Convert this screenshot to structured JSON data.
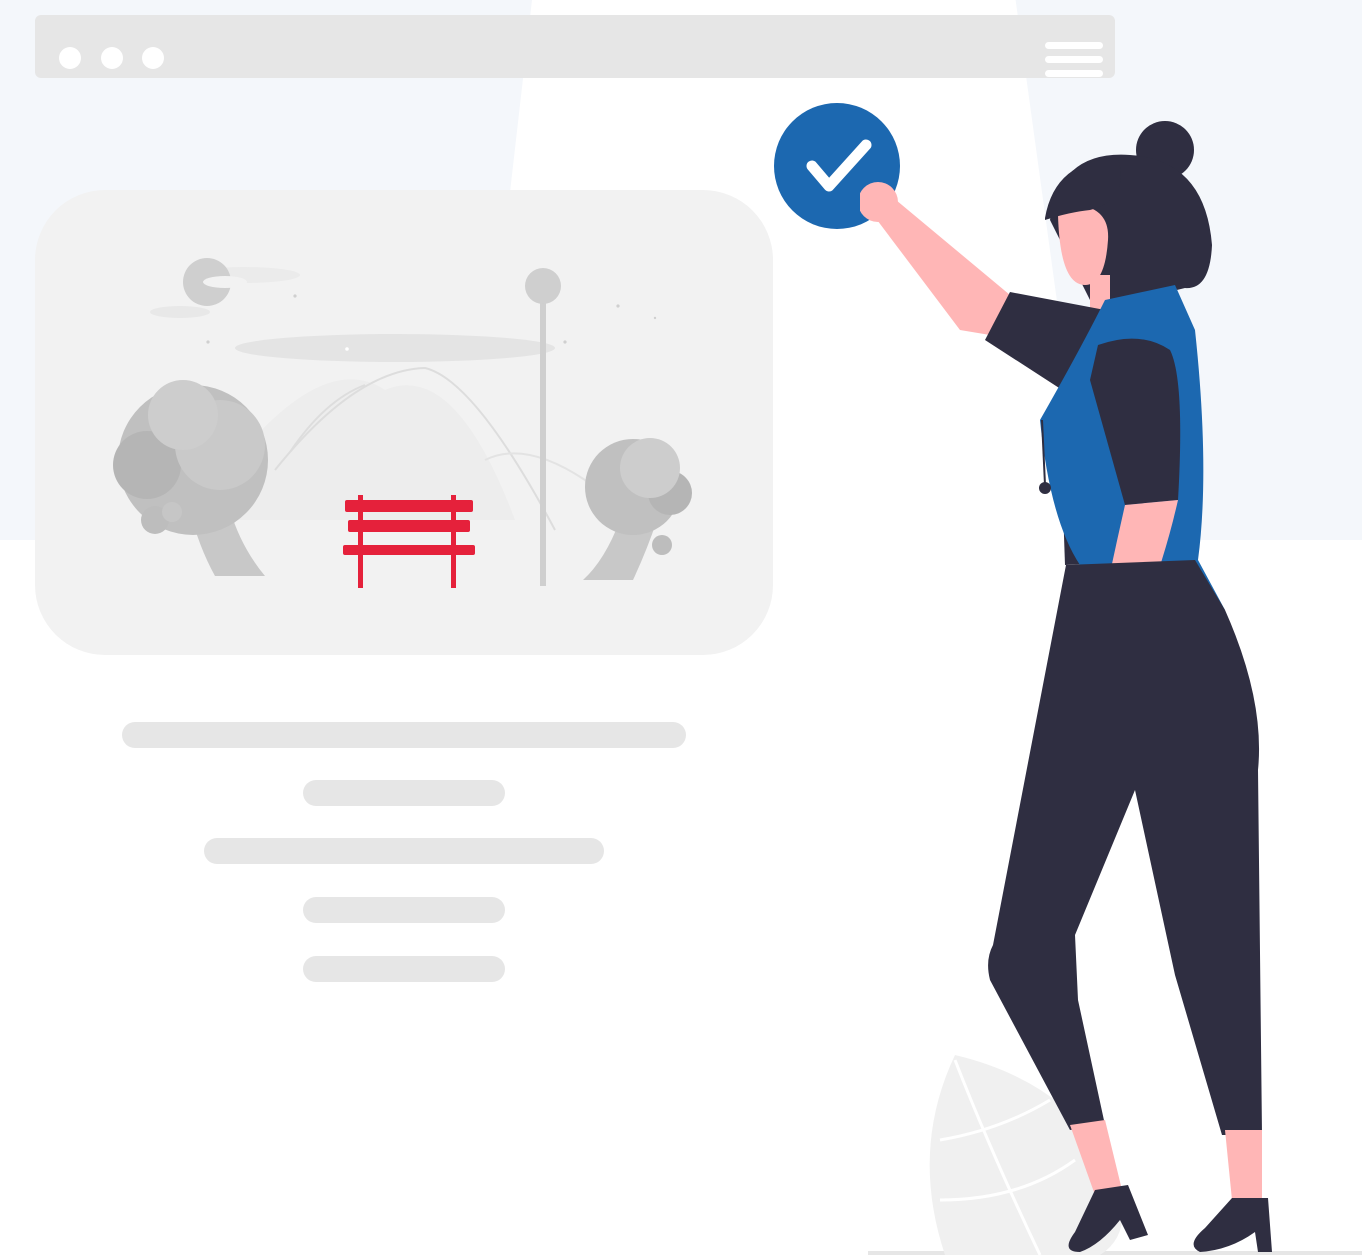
{
  "colors": {
    "background": "#ffffff",
    "background_tint": "#f4f7fb",
    "placeholder_gray": "#e6e6e6",
    "card_gray": "#f2f2f2",
    "accent_blue": "#1c68b0",
    "bench_red": "#e5213b",
    "dark": "#2f2e41",
    "skin": "#ffb6b6"
  },
  "browser": {
    "window_controls": [
      "window-dot-icon",
      "window-dot-icon",
      "window-dot-icon"
    ],
    "menu_icon": "hamburger-menu-icon"
  },
  "image_card": {
    "icon": "park-scene-image",
    "elements": [
      "moon-icon",
      "streetlamp-icon",
      "tree-icon",
      "bench-icon"
    ]
  },
  "text_placeholders": 5,
  "check_badge": {
    "icon": "checkmark-icon"
  },
  "illustration": {
    "name": "woman-figure"
  }
}
